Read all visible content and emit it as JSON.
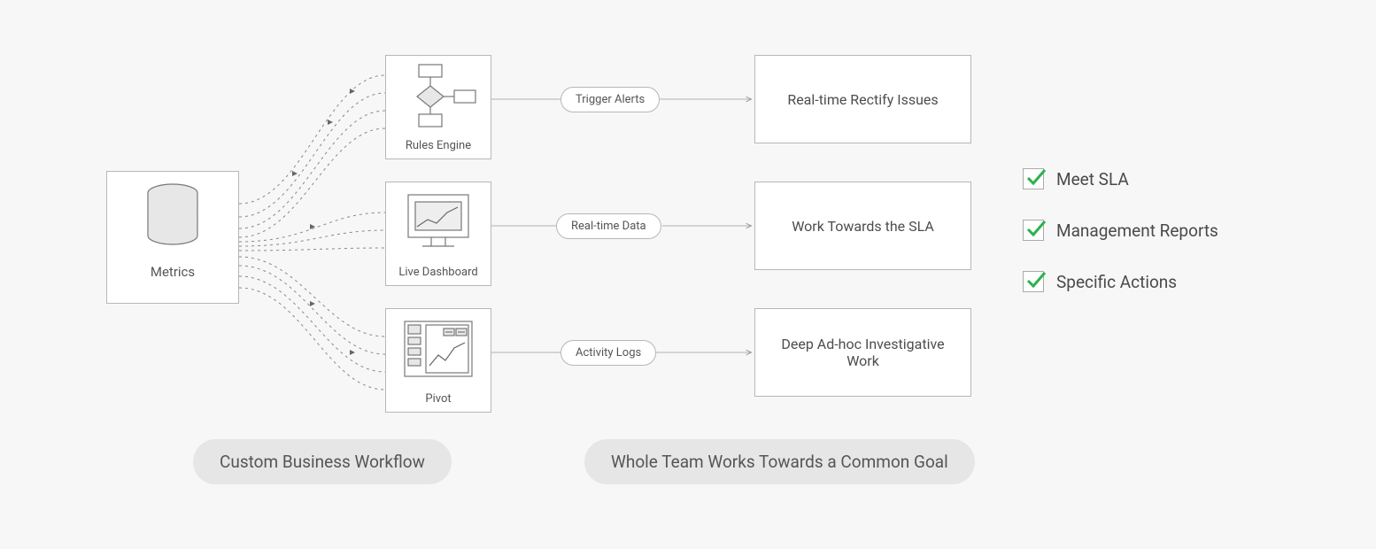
{
  "metrics": {
    "label": "Metrics"
  },
  "engines": {
    "rules": {
      "label": "Rules Engine"
    },
    "dash": {
      "label": "Live Dashboard"
    },
    "pivot": {
      "label": "Pivot"
    }
  },
  "pills": {
    "p1": "Trigger Alerts",
    "p2": "Real-time Data",
    "p3": "Activity Logs"
  },
  "outcomes": {
    "o1": "Real-time Rectify Issues",
    "o2": "Work Towards the SLA",
    "o3": "Deep Ad-hoc Investigative Work"
  },
  "sections": {
    "left": "Custom Business Workflow",
    "right": "Whole Team Works Towards a Common Goal"
  },
  "checklist": {
    "c1": "Meet SLA",
    "c2": "Management Reports",
    "c3": "Specific Actions"
  }
}
